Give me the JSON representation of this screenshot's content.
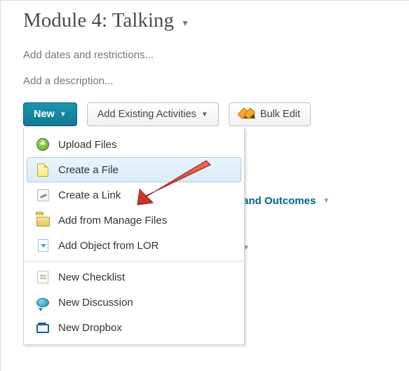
{
  "module": {
    "title": "Module 4: Talking",
    "add_dates_text": "Add dates and restrictions...",
    "add_description_text": "Add a description..."
  },
  "toolbar": {
    "new_label": "New",
    "add_existing_label": "Add Existing Activities",
    "bulk_edit_label": "Bulk Edit"
  },
  "new_menu": {
    "items": [
      {
        "label": "Upload Files",
        "icon": "upload-icon"
      },
      {
        "label": "Create a File",
        "icon": "file-icon",
        "highlighted": true
      },
      {
        "label": "Create a Link",
        "icon": "link-icon"
      },
      {
        "label": "Add from Manage Files",
        "icon": "folder-icon"
      },
      {
        "label": "Add Object from LOR",
        "icon": "lor-icon"
      },
      {
        "label": "New Checklist",
        "icon": "checklist-icon"
      },
      {
        "label": "New Discussion",
        "icon": "discussion-icon"
      },
      {
        "label": "New Dropbox",
        "icon": "dropbox-icon"
      }
    ]
  },
  "background": {
    "outcomes_fragment": "and Outcomes"
  },
  "annotation": {
    "arrow_points_to": "Create a File"
  }
}
